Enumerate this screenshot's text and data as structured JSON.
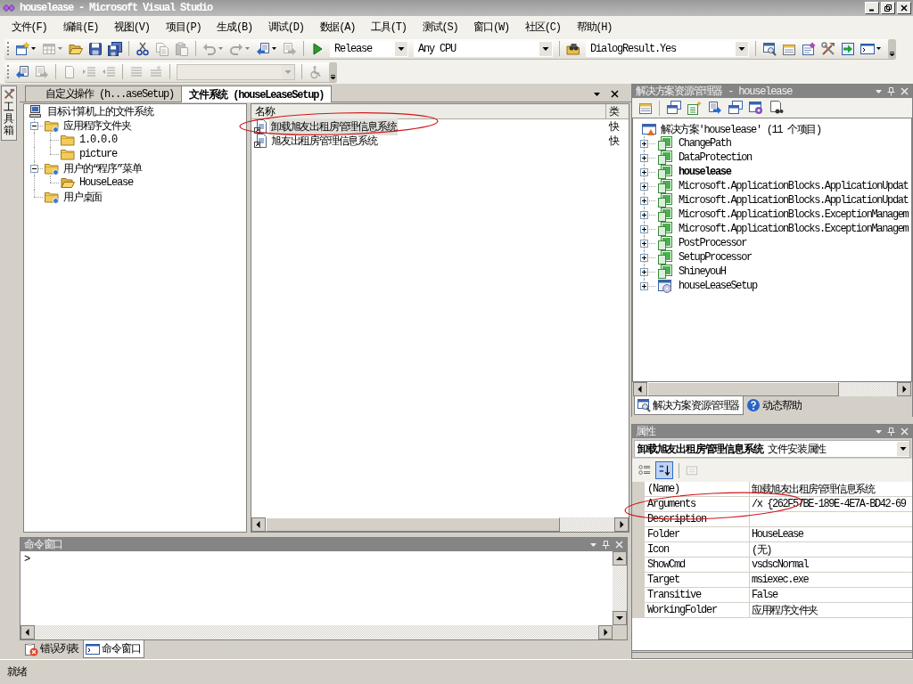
{
  "window": {
    "title": "houselease - Microsoft Visual Studio"
  },
  "menu": [
    "文件(F)",
    "编辑(E)",
    "视图(V)",
    "项目(P)",
    "生成(B)",
    "调试(D)",
    "数据(A)",
    "工具(T)",
    "测试(S)",
    "窗口(W)",
    "社区(C)",
    "帮助(H)"
  ],
  "standard_toolbar": [
    {
      "kind": "button",
      "disabled": false,
      "dropdown": true
    },
    {
      "kind": "button",
      "disabled": true,
      "dropdown": true
    },
    {
      "kind": "button",
      "disabled": false,
      "dropdown": false
    },
    {
      "kind": "button",
      "disabled": false,
      "dropdown": false
    },
    {
      "kind": "button",
      "disabled": false,
      "dropdown": false
    },
    {
      "kind": "separator"
    },
    {
      "kind": "button",
      "disabled": false,
      "dropdown": false
    },
    {
      "kind": "button",
      "disabled": true,
      "dropdown": false
    },
    {
      "kind": "button",
      "disabled": true,
      "dropdown": false
    },
    {
      "kind": "separator"
    },
    {
      "kind": "button",
      "disabled": true,
      "dropdown": true
    },
    {
      "kind": "button",
      "disabled": true,
      "dropdown": true
    },
    {
      "kind": "button",
      "disabled": false,
      "dropdown": true
    },
    {
      "kind": "button",
      "disabled": true,
      "dropdown": false
    },
    {
      "kind": "separator"
    },
    {
      "kind": "button",
      "disabled": false,
      "dropdown": false
    },
    {
      "kind": "combo",
      "value": "Release",
      "disabled": false
    },
    {
      "kind": "combo",
      "value": "Any CPU",
      "disabled": false
    },
    {
      "kind": "separator"
    },
    {
      "kind": "button",
      "disabled": false,
      "dropdown": false
    },
    {
      "kind": "combo",
      "value": "DialogResult.Yes",
      "disabled": false
    },
    {
      "kind": "separator"
    },
    {
      "kind": "button",
      "disabled": false,
      "dropdown": false
    },
    {
      "kind": "button",
      "disabled": false,
      "dropdown": false
    },
    {
      "kind": "button",
      "disabled": false,
      "dropdown": false
    },
    {
      "kind": "button",
      "disabled": false,
      "dropdown": false
    },
    {
      "kind": "button",
      "disabled": false,
      "dropdown": false
    },
    {
      "kind": "button",
      "disabled": false,
      "dropdown": true
    }
  ],
  "layout_toolbar": [
    {
      "kind": "button",
      "disabled": false,
      "dropdown": false
    },
    {
      "kind": "button",
      "disabled": true,
      "dropdown": false
    },
    {
      "kind": "separator"
    },
    {
      "kind": "button",
      "disabled": true,
      "dropdown": false
    },
    {
      "kind": "button",
      "disabled": true,
      "dropdown": false
    },
    {
      "kind": "button",
      "disabled": true,
      "dropdown": false
    },
    {
      "kind": "separator"
    },
    {
      "kind": "button",
      "disabled": true,
      "dropdown": false
    },
    {
      "kind": "button",
      "disabled": true,
      "dropdown": false
    },
    {
      "kind": "separator"
    },
    {
      "kind": "combo",
      "disabled": true
    },
    {
      "kind": "separator"
    },
    {
      "kind": "button",
      "disabled": true,
      "dropdown": false
    }
  ],
  "side_tabs": [
    {
      "label": "工具箱"
    }
  ],
  "document_tabs": [
    {
      "label": "自定义操作 (h...aseSetup)",
      "selected": false
    },
    {
      "label": "文件系统 (houseLeaseSetup)",
      "selected": true
    }
  ],
  "file_system_tree": [
    {
      "label": "目标计算机上的文件系统",
      "kind": "computer",
      "children": [
        {
          "label": "应用程序文件夹",
          "kind": "special_folder",
          "expanded": true,
          "children": [
            {
              "label": "1.0.0.0",
              "kind": "folder"
            },
            {
              "label": "picture",
              "kind": "folder"
            }
          ]
        },
        {
          "label": "用户的“程序”菜单",
          "kind": "special_folder",
          "expanded": true,
          "children": [
            {
              "label": "HouseLease",
              "kind": "open_folder"
            }
          ]
        },
        {
          "label": "用户桌面",
          "kind": "special_folder"
        }
      ]
    }
  ],
  "file_list": {
    "columns": [
      "名称",
      "类"
    ],
    "rows": [
      {
        "name": "卸载旭友出租房管理信息系统",
        "type": "快",
        "selected": true
      },
      {
        "name": "旭友出租房管理信息系统",
        "type": "快",
        "selected": false
      }
    ]
  },
  "command_window": {
    "title": "命令窗口",
    "prompt": ">"
  },
  "bottom_tabs": [
    {
      "label": "错误列表",
      "selected": false
    },
    {
      "label": "命令窗口",
      "selected": true
    }
  ],
  "solution_explorer": {
    "title": "解决方案资源管理器 - houselease",
    "root": "解决方案'houselease' (11 个项目)",
    "projects": [
      {
        "name": "ChangePath",
        "kind": "project",
        "expanded": false,
        "bold": false
      },
      {
        "name": "DataProtection",
        "kind": "project",
        "expanded": false,
        "bold": false
      },
      {
        "name": "houselease",
        "kind": "project",
        "expanded": false,
        "bold": true
      },
      {
        "name": "Microsoft.ApplicationBlocks.ApplicationUpdat",
        "kind": "project",
        "expanded": false,
        "bold": false
      },
      {
        "name": "Microsoft.ApplicationBlocks.ApplicationUpdat",
        "kind": "project",
        "expanded": false,
        "bold": false
      },
      {
        "name": "Microsoft.ApplicationBlocks.ExceptionManagem",
        "kind": "project",
        "expanded": false,
        "bold": false
      },
      {
        "name": "Microsoft.ApplicationBlocks.ExceptionManagem",
        "kind": "project",
        "expanded": false,
        "bold": false
      },
      {
        "name": "PostProcessor",
        "kind": "project",
        "expanded": false,
        "bold": false
      },
      {
        "name": "SetupProcessor",
        "kind": "project",
        "expanded": false,
        "bold": false
      },
      {
        "name": "ShineyouH",
        "kind": "project",
        "expanded": false,
        "bold": false
      },
      {
        "name": "houseLeaseSetup",
        "kind": "setup",
        "expanded": false,
        "bold": false
      }
    ]
  },
  "explorer_tabs": [
    {
      "label": "解决方案资源管理器",
      "selected": true
    },
    {
      "label": "动态帮助",
      "selected": false
    }
  ],
  "properties": {
    "title": "属性",
    "object": "**卸载旭友出租房管理信息系统** 文件安装属性",
    "view_buttons": [
      {
        "selected": false,
        "disabled": false
      },
      {
        "selected": true,
        "disabled": false
      },
      {
        "selected": false,
        "disabled": true
      }
    ],
    "rows": [
      {
        "name": "(Name)",
        "value": "卸载旭友出租房管理信息系统"
      },
      {
        "name": "Arguments",
        "value": "/x {262F57BE-189E-4E7A-BD42-69"
      },
      {
        "name": "Description"
      },
      {
        "name": "Folder",
        "value": "HouseLease"
      },
      {
        "name": "Icon",
        "value": "(无)"
      },
      {
        "name": "ShowCmd",
        "value": "vsdscNormal"
      },
      {
        "name": "Target",
        "value": "msiexec.exe"
      },
      {
        "name": "Transitive",
        "value": "False"
      },
      {
        "name": "WorkingFolder",
        "value": "应用程序文件夹"
      }
    ]
  },
  "status_bar": {
    "text": "就绪"
  }
}
